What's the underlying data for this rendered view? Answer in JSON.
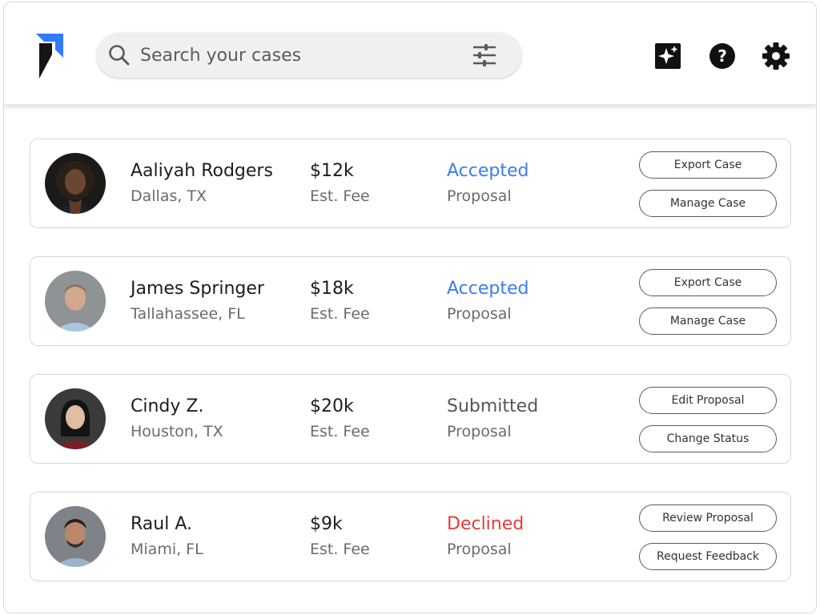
{
  "search": {
    "placeholder": "Search your cases"
  },
  "colors": {
    "accepted": "#3b7df0",
    "submitted": "#555555",
    "declined": "#e83a3a"
  },
  "icons": {
    "logo": "brand-logo-icon",
    "search": "search-icon",
    "filter": "filter-sliders-icon",
    "sparkle": "sparkle-icon",
    "help": "help-icon",
    "settings": "gear-icon"
  },
  "cases": [
    {
      "name": "Aaliyah Rodgers",
      "location": "Dallas, TX",
      "fee": "$12k",
      "fee_label": "Est. Fee",
      "status": "Accepted",
      "status_type": "accepted",
      "status_label": "Proposal",
      "actions": [
        "Export Case",
        "Manage Case"
      ]
    },
    {
      "name": "James Springer",
      "location": "Tallahassee, FL",
      "fee": "$18k",
      "fee_label": "Est. Fee",
      "status": "Accepted",
      "status_type": "accepted",
      "status_label": "Proposal",
      "actions": [
        "Export Case",
        "Manage Case"
      ]
    },
    {
      "name": "Cindy Z.",
      "location": "Houston, TX",
      "fee": "$20k",
      "fee_label": "Est. Fee",
      "status": "Submitted",
      "status_type": "submitted",
      "status_label": "Proposal",
      "actions": [
        "Edit Proposal",
        "Change Status"
      ]
    },
    {
      "name": "Raul A.",
      "location": "Miami, FL",
      "fee": "$9k",
      "fee_label": "Est. Fee",
      "status": "Declined",
      "status_type": "declined",
      "status_label": "Proposal",
      "actions": [
        "Review Proposal",
        "Request Feedback"
      ]
    }
  ]
}
